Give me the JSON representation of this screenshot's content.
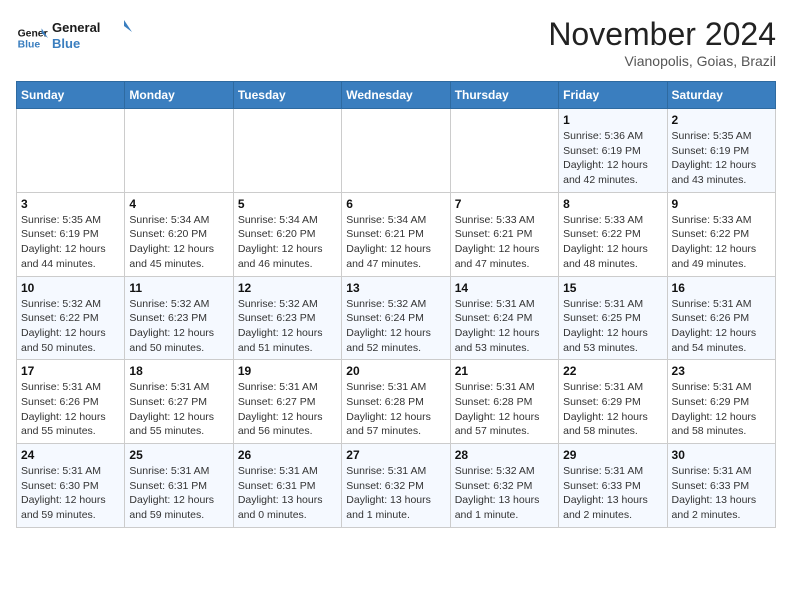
{
  "header": {
    "logo_line1": "General",
    "logo_line2": "Blue",
    "title": "November 2024",
    "subtitle": "Vianopolis, Goias, Brazil"
  },
  "weekdays": [
    "Sunday",
    "Monday",
    "Tuesday",
    "Wednesday",
    "Thursday",
    "Friday",
    "Saturday"
  ],
  "weeks": [
    [
      {
        "day": "",
        "info": ""
      },
      {
        "day": "",
        "info": ""
      },
      {
        "day": "",
        "info": ""
      },
      {
        "day": "",
        "info": ""
      },
      {
        "day": "",
        "info": ""
      },
      {
        "day": "1",
        "info": "Sunrise: 5:36 AM\nSunset: 6:19 PM\nDaylight: 12 hours and 42 minutes."
      },
      {
        "day": "2",
        "info": "Sunrise: 5:35 AM\nSunset: 6:19 PM\nDaylight: 12 hours and 43 minutes."
      }
    ],
    [
      {
        "day": "3",
        "info": "Sunrise: 5:35 AM\nSunset: 6:19 PM\nDaylight: 12 hours and 44 minutes."
      },
      {
        "day": "4",
        "info": "Sunrise: 5:34 AM\nSunset: 6:20 PM\nDaylight: 12 hours and 45 minutes."
      },
      {
        "day": "5",
        "info": "Sunrise: 5:34 AM\nSunset: 6:20 PM\nDaylight: 12 hours and 46 minutes."
      },
      {
        "day": "6",
        "info": "Sunrise: 5:34 AM\nSunset: 6:21 PM\nDaylight: 12 hours and 47 minutes."
      },
      {
        "day": "7",
        "info": "Sunrise: 5:33 AM\nSunset: 6:21 PM\nDaylight: 12 hours and 47 minutes."
      },
      {
        "day": "8",
        "info": "Sunrise: 5:33 AM\nSunset: 6:22 PM\nDaylight: 12 hours and 48 minutes."
      },
      {
        "day": "9",
        "info": "Sunrise: 5:33 AM\nSunset: 6:22 PM\nDaylight: 12 hours and 49 minutes."
      }
    ],
    [
      {
        "day": "10",
        "info": "Sunrise: 5:32 AM\nSunset: 6:22 PM\nDaylight: 12 hours and 50 minutes."
      },
      {
        "day": "11",
        "info": "Sunrise: 5:32 AM\nSunset: 6:23 PM\nDaylight: 12 hours and 50 minutes."
      },
      {
        "day": "12",
        "info": "Sunrise: 5:32 AM\nSunset: 6:23 PM\nDaylight: 12 hours and 51 minutes."
      },
      {
        "day": "13",
        "info": "Sunrise: 5:32 AM\nSunset: 6:24 PM\nDaylight: 12 hours and 52 minutes."
      },
      {
        "day": "14",
        "info": "Sunrise: 5:31 AM\nSunset: 6:24 PM\nDaylight: 12 hours and 53 minutes."
      },
      {
        "day": "15",
        "info": "Sunrise: 5:31 AM\nSunset: 6:25 PM\nDaylight: 12 hours and 53 minutes."
      },
      {
        "day": "16",
        "info": "Sunrise: 5:31 AM\nSunset: 6:26 PM\nDaylight: 12 hours and 54 minutes."
      }
    ],
    [
      {
        "day": "17",
        "info": "Sunrise: 5:31 AM\nSunset: 6:26 PM\nDaylight: 12 hours and 55 minutes."
      },
      {
        "day": "18",
        "info": "Sunrise: 5:31 AM\nSunset: 6:27 PM\nDaylight: 12 hours and 55 minutes."
      },
      {
        "day": "19",
        "info": "Sunrise: 5:31 AM\nSunset: 6:27 PM\nDaylight: 12 hours and 56 minutes."
      },
      {
        "day": "20",
        "info": "Sunrise: 5:31 AM\nSunset: 6:28 PM\nDaylight: 12 hours and 57 minutes."
      },
      {
        "day": "21",
        "info": "Sunrise: 5:31 AM\nSunset: 6:28 PM\nDaylight: 12 hours and 57 minutes."
      },
      {
        "day": "22",
        "info": "Sunrise: 5:31 AM\nSunset: 6:29 PM\nDaylight: 12 hours and 58 minutes."
      },
      {
        "day": "23",
        "info": "Sunrise: 5:31 AM\nSunset: 6:29 PM\nDaylight: 12 hours and 58 minutes."
      }
    ],
    [
      {
        "day": "24",
        "info": "Sunrise: 5:31 AM\nSunset: 6:30 PM\nDaylight: 12 hours and 59 minutes."
      },
      {
        "day": "25",
        "info": "Sunrise: 5:31 AM\nSunset: 6:31 PM\nDaylight: 12 hours and 59 minutes."
      },
      {
        "day": "26",
        "info": "Sunrise: 5:31 AM\nSunset: 6:31 PM\nDaylight: 13 hours and 0 minutes."
      },
      {
        "day": "27",
        "info": "Sunrise: 5:31 AM\nSunset: 6:32 PM\nDaylight: 13 hours and 1 minute."
      },
      {
        "day": "28",
        "info": "Sunrise: 5:32 AM\nSunset: 6:32 PM\nDaylight: 13 hours and 1 minute."
      },
      {
        "day": "29",
        "info": "Sunrise: 5:31 AM\nSunset: 6:33 PM\nDaylight: 13 hours and 2 minutes."
      },
      {
        "day": "30",
        "info": "Sunrise: 5:31 AM\nSunset: 6:33 PM\nDaylight: 13 hours and 2 minutes."
      }
    ]
  ]
}
